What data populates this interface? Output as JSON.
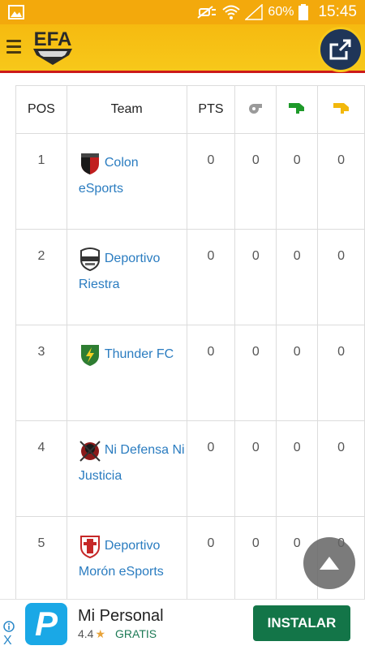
{
  "status_bar": {
    "battery_percent": "60%",
    "time": "15:45"
  },
  "header": {
    "logo_text": "EFA"
  },
  "table": {
    "columns": [
      "POS",
      "Team",
      "PTS",
      "whistle-icon",
      "green-card-icon",
      "yellow-card-icon"
    ],
    "rows": [
      {
        "pos": "1",
        "team": "Colon eSports",
        "pts": "0",
        "c1": "0",
        "c2": "0",
        "c3": "0"
      },
      {
        "pos": "2",
        "team": "Deportivo Riestra",
        "pts": "0",
        "c1": "0",
        "c2": "0",
        "c3": "0"
      },
      {
        "pos": "3",
        "team": "Thunder FC",
        "pts": "0",
        "c1": "0",
        "c2": "0",
        "c3": "0"
      },
      {
        "pos": "4",
        "team": "Ni Defensa Ni Justicia",
        "pts": "0",
        "c1": "0",
        "c2": "0",
        "c3": "0"
      },
      {
        "pos": "5",
        "team": "Deportivo Morón eSports",
        "pts": "0",
        "c1": "0",
        "c2": "0",
        "c3": "0"
      }
    ]
  },
  "ad": {
    "app_name": "Mi Personal",
    "icon_letter": "P",
    "rating": "4.4",
    "price": "GRATIS",
    "cta": "INSTALAR",
    "close": "X"
  },
  "colors": {
    "status_bar": "#f3a90c",
    "header": "#f7c81a",
    "accent_line": "#cc1a1a",
    "link": "#2a7cc0",
    "install_button": "#137548"
  }
}
